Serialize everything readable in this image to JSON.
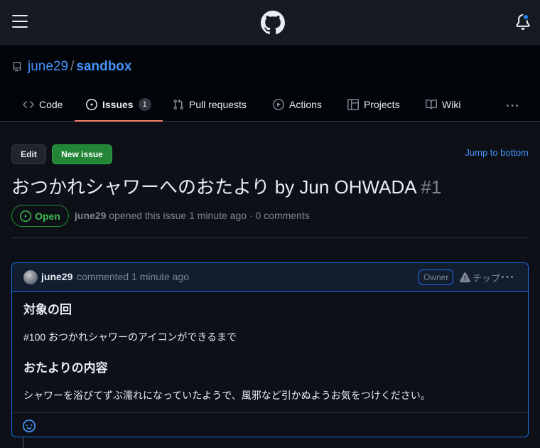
{
  "repo": {
    "owner": "june29",
    "separator": "/",
    "name": "sandbox"
  },
  "tabs": [
    {
      "label": "Code",
      "icon": "code-icon"
    },
    {
      "label": "Issues",
      "icon": "issue-opened-icon",
      "count": "1",
      "active": true
    },
    {
      "label": "Pull requests",
      "icon": "git-pull-request-icon"
    },
    {
      "label": "Actions",
      "icon": "play-icon"
    },
    {
      "label": "Projects",
      "icon": "table-icon"
    },
    {
      "label": "Wiki",
      "icon": "book-icon"
    }
  ],
  "toolbar": {
    "edit_label": "Edit",
    "new_issue_label": "New issue",
    "jump_label": "Jump to bottom"
  },
  "issue": {
    "title": "おつかれシャワーへのおたより by Jun OHWADA",
    "number": "#1",
    "state": "Open",
    "author": "june29",
    "meta_text": "opened this issue 1 minute ago · 0 comments"
  },
  "comment": {
    "author": "june29",
    "meta_text": "commented 1 minute ago",
    "badge": "Owner",
    "tip_label": "チップ",
    "heading1": "対象の回",
    "paragraph1": "#100 おつかれシャワーのアイコンができるまで",
    "heading2": "おたよりの内容",
    "paragraph2": "シャワーを浴びてずぶ濡れになっていたようで、風邪など引かぬようお気をつけください。"
  },
  "colors": {
    "background": "#0d1117",
    "header": "#161b22",
    "link": "#4493f8",
    "open_green": "#3fb950",
    "button_green": "#238636",
    "active_tab_underline": "#f78166",
    "notification_dot": "#2f81f7"
  }
}
